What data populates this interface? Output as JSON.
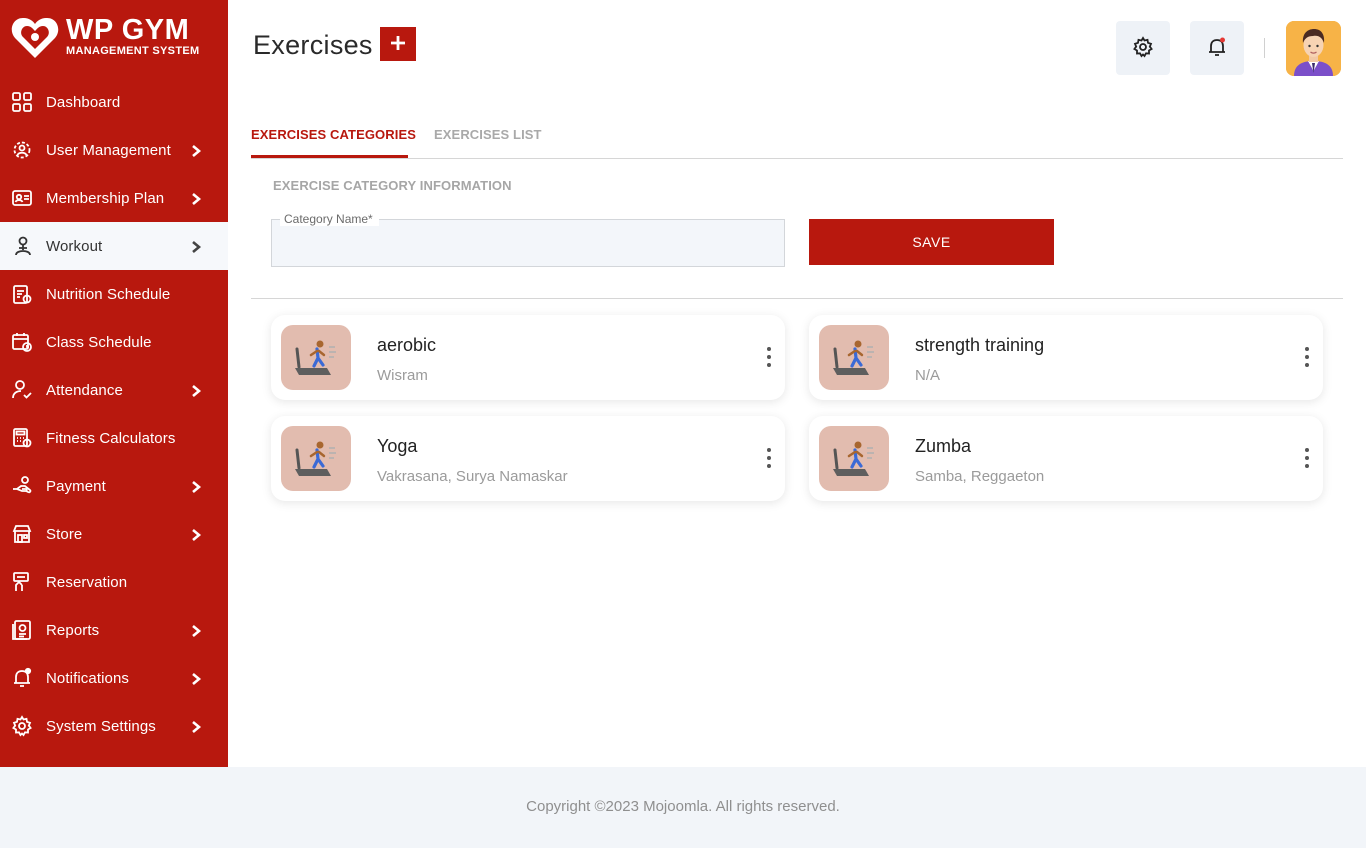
{
  "brand": {
    "title": "WP GYM",
    "subtitle": "MANAGEMENT SYSTEM",
    "color": "#b8180e"
  },
  "sidebar": {
    "items": [
      {
        "label": "Dashboard",
        "icon": "dashboard-icon",
        "has_submenu": false,
        "active": false
      },
      {
        "label": "User Management",
        "icon": "users-gear-icon",
        "has_submenu": true,
        "active": false
      },
      {
        "label": "Membership Plan",
        "icon": "membership-card-icon",
        "has_submenu": true,
        "active": false
      },
      {
        "label": "Workout",
        "icon": "workout-icon",
        "has_submenu": true,
        "active": true
      },
      {
        "label": "Nutrition Schedule",
        "icon": "nutrition-clipboard-icon",
        "has_submenu": false,
        "active": false
      },
      {
        "label": "Class Schedule",
        "icon": "calendar-clock-icon",
        "has_submenu": false,
        "active": false
      },
      {
        "label": "Attendance",
        "icon": "user-check-icon",
        "has_submenu": true,
        "active": false
      },
      {
        "label": "Fitness Calculators",
        "icon": "calculator-icon",
        "has_submenu": false,
        "active": false
      },
      {
        "label": "Payment",
        "icon": "payment-hand-icon",
        "has_submenu": true,
        "active": false
      },
      {
        "label": "Store",
        "icon": "store-icon",
        "has_submenu": true,
        "active": false
      },
      {
        "label": "Reservation",
        "icon": "reservation-icon",
        "has_submenu": false,
        "active": false
      },
      {
        "label": "Reports",
        "icon": "reports-icon",
        "has_submenu": true,
        "active": false
      },
      {
        "label": "Notifications",
        "icon": "bell-icon",
        "has_submenu": true,
        "active": false
      },
      {
        "label": "System Settings",
        "icon": "gear-icon",
        "has_submenu": true,
        "active": false
      }
    ]
  },
  "header": {
    "title": "Exercises",
    "add_icon": "plus-icon",
    "settings_icon": "gear-icon",
    "notifications_icon": "bell-icon",
    "notification_dot_color": "#e53935"
  },
  "tabs": {
    "active": "EXERCISES CATEGORIES",
    "inactive": "EXERCISES LIST"
  },
  "form": {
    "section_title": "EXERCISE CATEGORY INFORMATION",
    "field_label": "Category Name*",
    "field_value": "",
    "save_label": "SAVE"
  },
  "categories": [
    {
      "name": "aerobic",
      "exercises": "Wisram"
    },
    {
      "name": "strength training",
      "exercises": "N/A"
    },
    {
      "name": "Yoga",
      "exercises": "Vakrasana, Surya Namaskar"
    },
    {
      "name": "Zumba",
      "exercises": "Samba, Reggaeton"
    }
  ],
  "footer": {
    "copyright": "Copyright ©2023 Mojoomla. All rights reserved."
  }
}
